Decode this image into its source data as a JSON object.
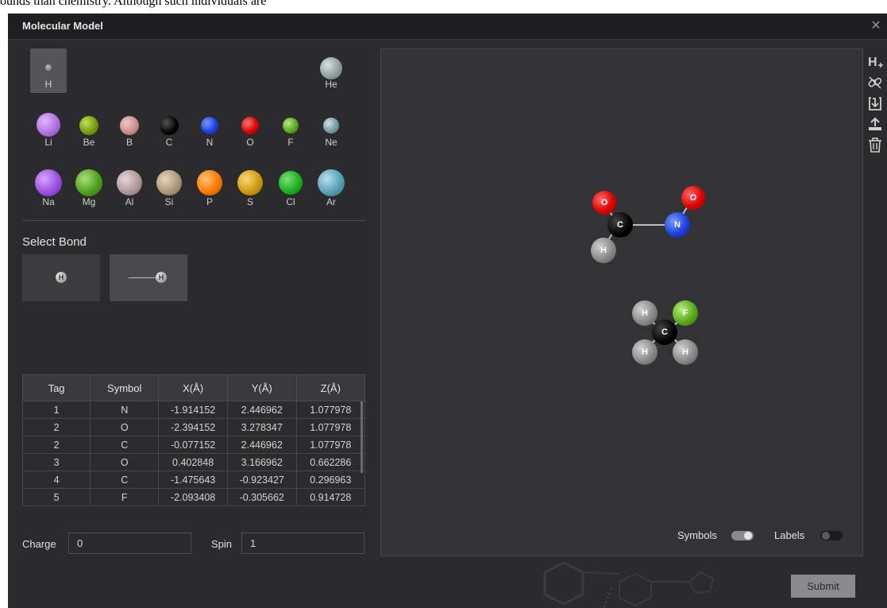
{
  "background": {
    "text": "ounds than chemistry. Although such individuals are"
  },
  "dialog": {
    "title": "Molecular Model",
    "close_label": "×"
  },
  "elements": {
    "row1": [
      {
        "symbol": "H"
      },
      {
        "symbol": "He"
      }
    ],
    "row2": [
      {
        "symbol": "Li"
      },
      {
        "symbol": "Be"
      },
      {
        "symbol": "B"
      },
      {
        "symbol": "C"
      },
      {
        "symbol": "N"
      },
      {
        "symbol": "O"
      },
      {
        "symbol": "F"
      },
      {
        "symbol": "Ne"
      }
    ],
    "row3": [
      {
        "symbol": "Na"
      },
      {
        "symbol": "Mg"
      },
      {
        "symbol": "Al"
      },
      {
        "symbol": "Si"
      },
      {
        "symbol": "P"
      },
      {
        "symbol": "S"
      },
      {
        "symbol": "Cl"
      },
      {
        "symbol": "Ar"
      }
    ],
    "selected": "H"
  },
  "bond": {
    "title": "Select Bond",
    "options": [
      {
        "badge": "H"
      },
      {
        "badge": "H"
      }
    ]
  },
  "table": {
    "headers": [
      "Tag",
      "Symbol",
      "X(Å)",
      "Y(Å)",
      "Z(Å)"
    ],
    "rows": [
      [
        "1",
        "N",
        "-1.914152",
        "2.446962",
        "1.077978"
      ],
      [
        "2",
        "O",
        "-2.394152",
        "3.278347",
        "1.077978"
      ],
      [
        "2",
        "C",
        "-0.077152",
        "2.446962",
        "1.077978"
      ],
      [
        "3",
        "O",
        "0.402848",
        "3.166962",
        "0.662286"
      ],
      [
        "4",
        "C",
        "-1.475643",
        "-0.923427",
        "0.296963"
      ],
      [
        "5",
        "F",
        "-2.093408",
        "-0.305662",
        "0.914728"
      ]
    ]
  },
  "charge": {
    "label": "Charge",
    "value": "0"
  },
  "spin": {
    "label": "Spin",
    "value": "1"
  },
  "viewer": {
    "atom_labels": {
      "o1": "O",
      "c1": "C",
      "h1": "H",
      "o2": "O",
      "n1": "N",
      "h2": "H",
      "f1": "F",
      "c2": "C",
      "h3": "H",
      "h4": "H"
    },
    "symbols_toggle": {
      "label": "Symbols",
      "on": true
    },
    "labels_toggle": {
      "label": "Labels",
      "on": false
    }
  },
  "toolbar": {
    "icons": [
      "add-hydrogen-icon",
      "unlink-icon",
      "import-icon",
      "upload-icon",
      "trash-icon"
    ]
  },
  "submit_label": "Submit",
  "colors": {
    "H": "#8a8a8a",
    "He": "#97a8a6",
    "Li": "#b070e0",
    "Be": "#7a9a10",
    "B": "#c9908e",
    "C": "#000000",
    "N": "#1e40e0",
    "O": "#e00000",
    "F": "#5aa820",
    "Ne": "#7a9aa8",
    "Na": "#9a50e0",
    "Mg": "#50a020",
    "Al": "#b09a9a",
    "Si": "#b0987a",
    "P": "#ff7a00",
    "S": "#d09a10",
    "Cl": "#20b020",
    "Ar": "#5aa0b8"
  }
}
